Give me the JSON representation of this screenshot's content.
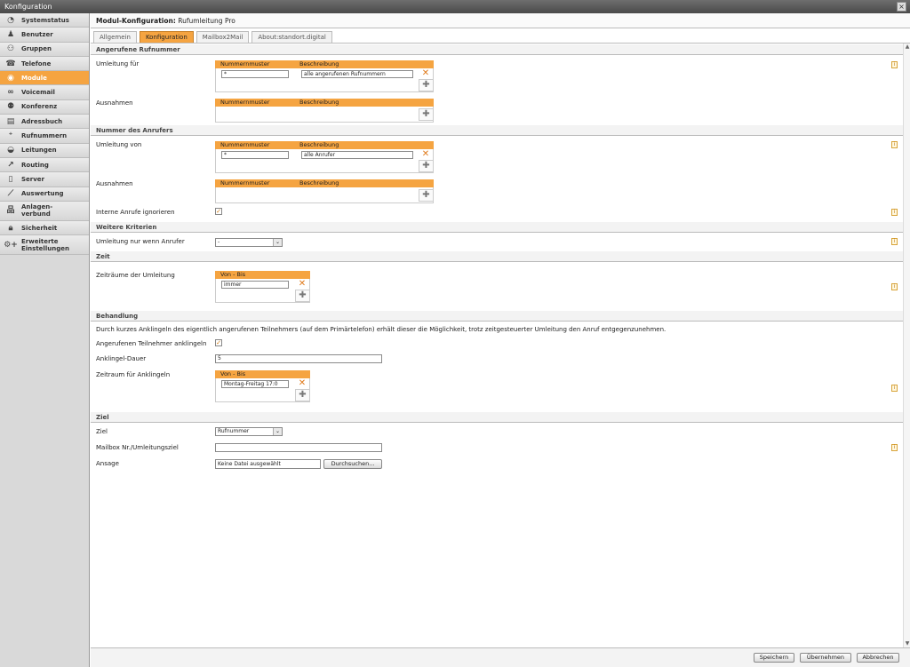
{
  "window": {
    "title": "Konfiguration",
    "close_label": "×"
  },
  "sidebar": {
    "items": [
      {
        "label": "Systemstatus",
        "icon": "◔"
      },
      {
        "label": "Benutzer",
        "icon": "♟"
      },
      {
        "label": "Gruppen",
        "icon": "⚇"
      },
      {
        "label": "Telefone",
        "icon": "☎"
      },
      {
        "label": "Module",
        "icon": "◉"
      },
      {
        "label": "Voicemail",
        "icon": "∞"
      },
      {
        "label": "Konferenz",
        "icon": "⚉"
      },
      {
        "label": "Adressbuch",
        "icon": "▤"
      },
      {
        "label": "Rufnummern",
        "icon": "⁺"
      },
      {
        "label": "Leitungen",
        "icon": "◒"
      },
      {
        "label": "Routing",
        "icon": "↗"
      },
      {
        "label": "Server",
        "icon": "▯"
      },
      {
        "label": "Auswertung",
        "icon": "⟋"
      },
      {
        "label": "Anlagen-",
        "label2": "verbund",
        "icon": "品"
      },
      {
        "label": "Sicherheit",
        "icon": "🔒︎"
      },
      {
        "label": "Erweiterte",
        "label2": "Einstellungen",
        "icon": "⚙+"
      }
    ],
    "active_index": 4
  },
  "module": {
    "prefix": "Modul-Konfiguration:",
    "name": "Rufumleitung Pro"
  },
  "tabs": [
    "Allgemein",
    "Konfiguration",
    "Mailbox2Mail",
    "About:standort.digital"
  ],
  "sections": {
    "angerufene": "Angerufene Rufnummer",
    "anrufer": "Nummer des Anrufers",
    "kriterien": "Weitere Kriterien",
    "zeit": "Zeit",
    "behandlung": "Behandlung",
    "ziel": "Ziel"
  },
  "labels": {
    "umleitung_fuer": "Umleitung für",
    "ausnahmen": "Ausnahmen",
    "umleitung_von": "Umleitung von",
    "interne_ignorieren": "Interne Anrufe ignorieren",
    "nur_wenn": "Umleitung nur wenn Anrufer",
    "zeitraeume": "Zeiträume der Umleitung",
    "anklingeln_text": "Durch kurzes Anklingeln des eigentlich angerufenen Teilnehmers (auf dem Primärtelefon) erhält dieser die Möglichkeit, trotz zeitgesteuerter Umleitung den Anruf entgegenzunehmen.",
    "anklingeln": "Angerufenen Teilnehmer anklingeln",
    "dauer": "Anklingel-Dauer",
    "zeitraum_anklingeln": "Zeitraum für Anklingeln",
    "ziel": "Ziel",
    "mailbox": "Mailbox Nr./Umleitungsziel",
    "ansage": "Ansage"
  },
  "grid_headers": {
    "nummernmuster": "Nummernmuster",
    "beschreibung": "Beschreibung",
    "von_bis": "Von - Bis"
  },
  "values": {
    "umleitung_fuer_muster": "*",
    "umleitung_fuer_beschreibung": "alle angerufenen Rufnummern",
    "umleitung_von_muster": "*",
    "umleitung_von_beschreibung": "alle Anrufer",
    "nur_wenn": "-",
    "zeitraum": "immer",
    "dauer": "5",
    "zeitraum_anklingeln": "Montag-Freitag 17:0",
    "ziel": "Rufnummer",
    "mailbox": "",
    "datei": "Keine Datei ausgewählt",
    "durchsuchen": "Durchsuchen..."
  },
  "checkboxes": {
    "interne_ignorieren": true,
    "anklingeln": true
  },
  "footer": {
    "speichern": "Speichern",
    "uebernehmen": "Übernehmen",
    "abbrechen": "Abbrechen"
  },
  "icons": {
    "remove": "✕",
    "add": "✚",
    "info": "i",
    "check": "✓",
    "dropdown": "⌄"
  },
  "colors": {
    "accent": "#f5a441",
    "sidebar_bg": "#d9d9d9"
  }
}
